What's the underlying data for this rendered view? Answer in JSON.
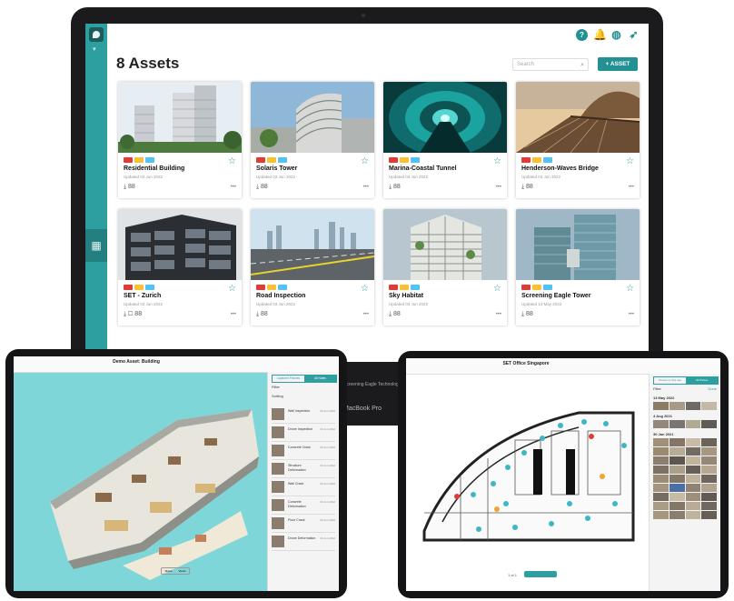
{
  "desktop": {
    "page_title": "8 Assets",
    "search_placeholder": "Search",
    "add_button": "+ ASSET",
    "footer_brand": "Screening Eagle Technologies",
    "footer_model": "MacBook Pro",
    "assets": [
      {
        "name": "Residential Building",
        "updated": "Updated 03 Jun 2022",
        "footer": "⤓ 88"
      },
      {
        "name": "Solaris Tower",
        "updated": "Updated 03 Jun 2022",
        "footer": "⤓ 88"
      },
      {
        "name": "Marina-Coastal Tunnel",
        "updated": "Updated 03 Jun 2022",
        "footer": "⤓ 88"
      },
      {
        "name": "Henderson-Waves Bridge",
        "updated": "Updated 03 Jun 2022",
        "footer": "⤓ 88"
      },
      {
        "name": "SET - Zurich",
        "updated": "Updated 03 Jun 2022",
        "footer": "⤓ ▢ 88"
      },
      {
        "name": "Road Inspection",
        "updated": "Updated 03 Jun 2022",
        "footer": "⤓ 88"
      },
      {
        "name": "Sky Habitat",
        "updated": "Updated 03 Jun 2022",
        "footer": "⤓ 88"
      },
      {
        "name": "Screening Eagle Tower",
        "updated": "Updated 13 May 2022",
        "footer": "⤓ 88"
      }
    ],
    "more_label": "•••",
    "colors": {
      "accent": "#239194",
      "tag_red": "#e53935",
      "tag_yellow": "#fbc02d",
      "tag_blue": "#4fc3f7"
    }
  },
  "ipad_left": {
    "title": "Demo Asset: Building",
    "seg_1": "Captured Pictures",
    "seg_2": "All Notes",
    "filter": "Filter",
    "sort": "Sorting",
    "items": [
      {
        "label": "Wall Inspection",
        "date": "03 Jun 2022"
      },
      {
        "label": "Drone Inspection",
        "date": "03 Jun 2022"
      },
      {
        "label": "Concrete Crack",
        "date": "03 Jun 2022"
      },
      {
        "label": "Structure Deformation",
        "date": "03 Jun 2022"
      },
      {
        "label": "Wall Crack",
        "date": "03 Jun 2022"
      },
      {
        "label": "Concrete Deformation",
        "date": "03 Jun 2022"
      },
      {
        "label": "Floor Crack",
        "date": "03 Jun 2022"
      },
      {
        "label": "Drone Deformation",
        "date": "03 Jun 2022"
      }
    ],
    "pill_1": "Slices",
    "pill_2": "Views"
  },
  "ipad_right": {
    "title": "SET Office Singapore",
    "seg_1": "Photos on this site",
    "seg_2": "All Photos",
    "filter": "Filter",
    "done": "Done",
    "date_1": "13 May 2022",
    "date_2": "4 Aug 2021",
    "date_3": "30 Jan 2021",
    "page": "1 of 1"
  }
}
